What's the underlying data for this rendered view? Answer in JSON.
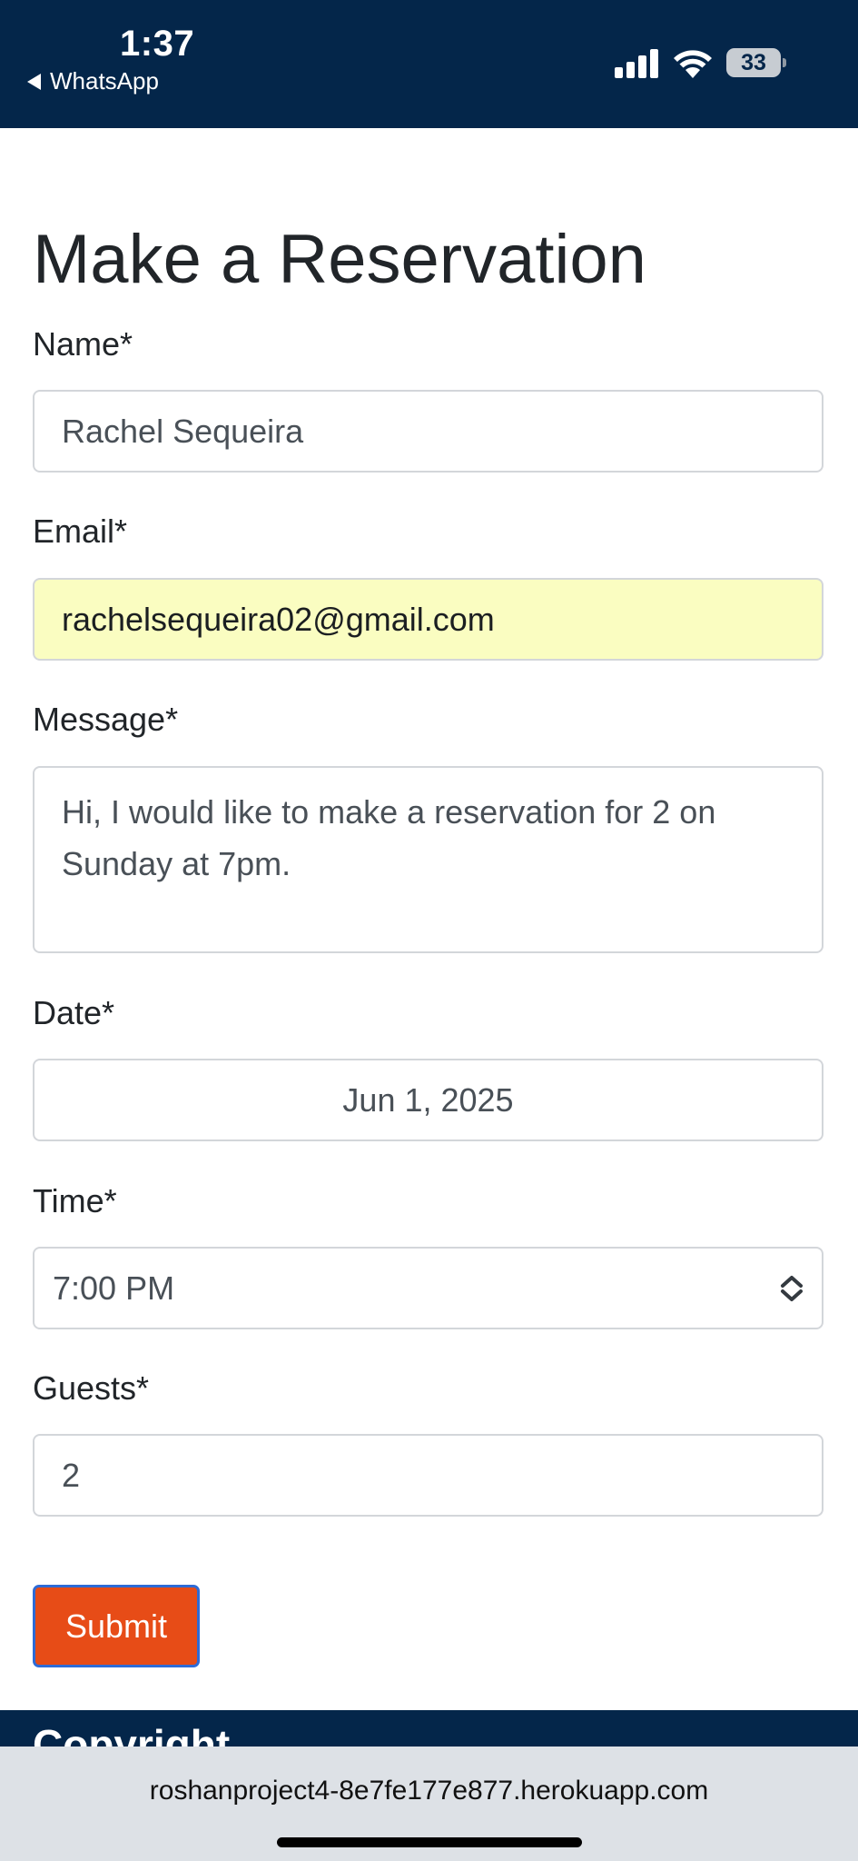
{
  "status_bar": {
    "time": "1:37",
    "back_app": "WhatsApp",
    "battery": "33",
    "background_color": "#04264a",
    "icons": [
      "cellular-signal-icon",
      "wifi-icon",
      "battery-icon"
    ]
  },
  "form": {
    "title": "Make a Reservation",
    "name": {
      "label": "Name*",
      "value": "Rachel Sequeira"
    },
    "email": {
      "label": "Email*",
      "value": "rachelsequeira02@gmail.com",
      "autofill_color": "#fafdc1"
    },
    "message": {
      "label": "Message*",
      "value": "Hi, I would like to make a reservation for 2 on Sunday at 7pm."
    },
    "date": {
      "label": "Date*",
      "value": "Jun 1, 2025"
    },
    "time": {
      "label": "Time*",
      "value": "7:00 PM"
    },
    "guests": {
      "label": "Guests*",
      "value": "2"
    },
    "submit_label": "Submit",
    "submit_color": "#e74c17"
  },
  "footer": {
    "heading": "Copyright",
    "background_color": "#04264a"
  },
  "browser": {
    "url": "roshanproject4-8e7fe177e877.herokuapp.com"
  }
}
